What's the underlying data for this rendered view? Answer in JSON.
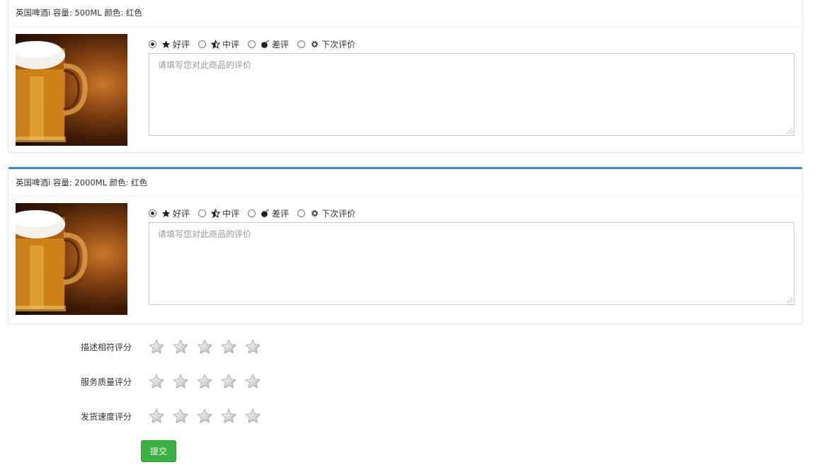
{
  "reviews": [
    {
      "product": "英国啤酒i 容量: 500ML 颜色: 红色",
      "options": [
        {
          "icon": "star-icon",
          "label": "好评",
          "checked": true
        },
        {
          "icon": "half-star-icon",
          "label": "中评",
          "checked": false
        },
        {
          "icon": "bomb-icon",
          "label": "差评",
          "checked": false
        },
        {
          "icon": "gear-icon",
          "label": "下次评价",
          "checked": false
        }
      ],
      "placeholder": "请填写您对此商品的评价"
    },
    {
      "product": "英国啤酒i 容量: 2000ML 颜色: 红色",
      "options": [
        {
          "icon": "star-icon",
          "label": "好评",
          "checked": true
        },
        {
          "icon": "half-star-icon",
          "label": "中评",
          "checked": false
        },
        {
          "icon": "bomb-icon",
          "label": "差评",
          "checked": false
        },
        {
          "icon": "gear-icon",
          "label": "下次评价",
          "checked": false
        }
      ],
      "placeholder": "请填写您对此商品的评价"
    }
  ],
  "ratings": [
    {
      "label": "描述相符评分",
      "stars": 5,
      "value": 0
    },
    {
      "label": "服务质量评分",
      "stars": 5,
      "value": 0
    },
    {
      "label": "发货速度评分",
      "stars": 5,
      "value": 0
    }
  ],
  "submit_label": "提交",
  "colors": {
    "accent": "#3c8dbc",
    "submit": "#3cb043"
  }
}
